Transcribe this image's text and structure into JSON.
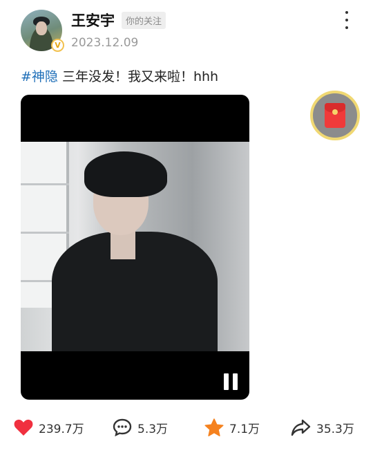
{
  "author": {
    "name": "王安宇",
    "relationship_badge": "你的关注",
    "verified_mark": "V",
    "date": "2023.12.09"
  },
  "post": {
    "hashtag": "#神隐",
    "text": " 三年没发！我又来啦！hhh"
  },
  "video": {
    "state": "playing",
    "control_icon": "pause-icon"
  },
  "actions": {
    "like": {
      "icon": "heart-icon",
      "count": "239.7万",
      "color": "#f0303f"
    },
    "comment": {
      "icon": "comment-icon",
      "count": "5.3万"
    },
    "favorite": {
      "icon": "star-icon",
      "count": "7.1万",
      "color": "#f5821f"
    },
    "share": {
      "icon": "share-icon",
      "count": "35.3万"
    }
  },
  "floating": {
    "icon": "red-envelope-icon"
  },
  "colors": {
    "hashtag": "#1f6fb8",
    "badge_bg": "#eeeeee",
    "date": "#999999"
  }
}
